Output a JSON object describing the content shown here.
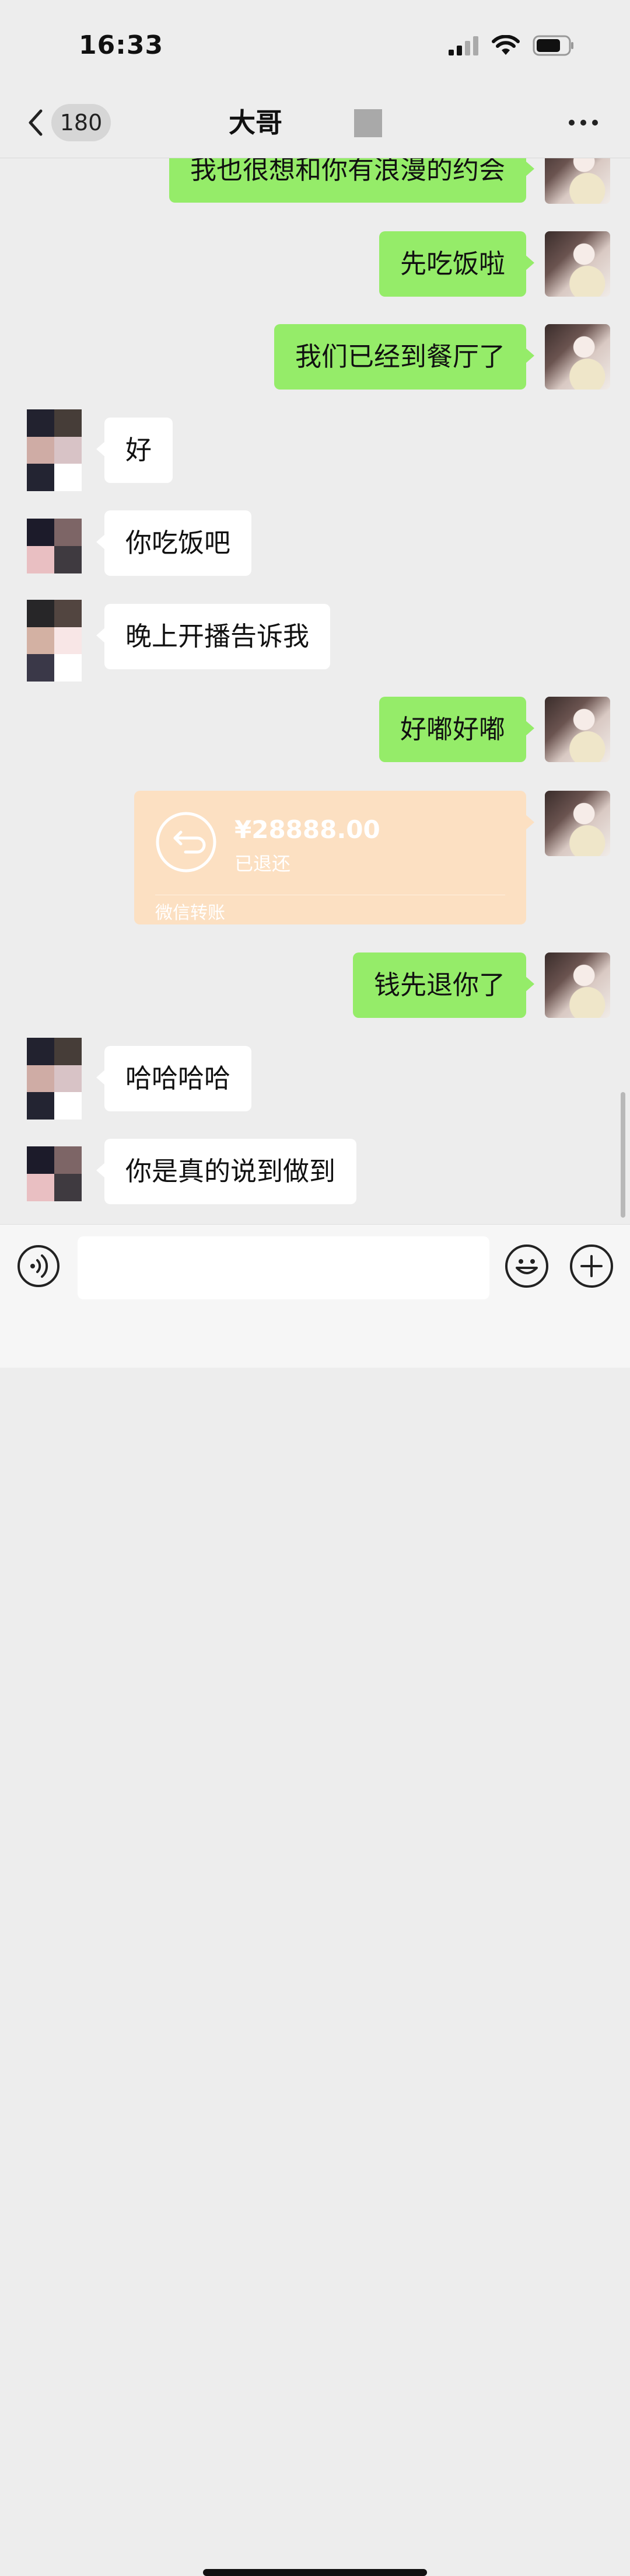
{
  "status_bar": {
    "time": "16:33"
  },
  "nav": {
    "badge_count": "180",
    "title": "大哥"
  },
  "messages": [
    {
      "side": "out",
      "text": "我也很想和你有浪漫的约会"
    },
    {
      "side": "out",
      "text": "先吃饭啦"
    },
    {
      "side": "out",
      "text": "我们已经到餐厅了"
    },
    {
      "side": "in",
      "text": "好"
    },
    {
      "side": "in",
      "text": "你吃饭吧"
    },
    {
      "side": "in",
      "text": "晚上开播告诉我"
    },
    {
      "side": "out",
      "text": "好嘟好嘟"
    },
    {
      "side": "out",
      "text": "钱先退你了"
    },
    {
      "side": "in",
      "text": "哈哈哈哈"
    },
    {
      "side": "in",
      "text": "你是真的说到做到"
    }
  ],
  "transfer": {
    "amount": "¥28888.00",
    "status": "已退还",
    "label": "微信转账"
  },
  "colors": {
    "outgoing_bubble": "#95ec69",
    "incoming_bubble": "#ffffff",
    "transfer_card": "#fce0c2",
    "background": "#ededed"
  },
  "icons": [
    "back-chevron-icon",
    "more-dots-icon",
    "voice-icon",
    "emoji-icon",
    "plus-icon",
    "refund-arrow-icon",
    "signal-icon",
    "wifi-icon",
    "battery-icon"
  ]
}
